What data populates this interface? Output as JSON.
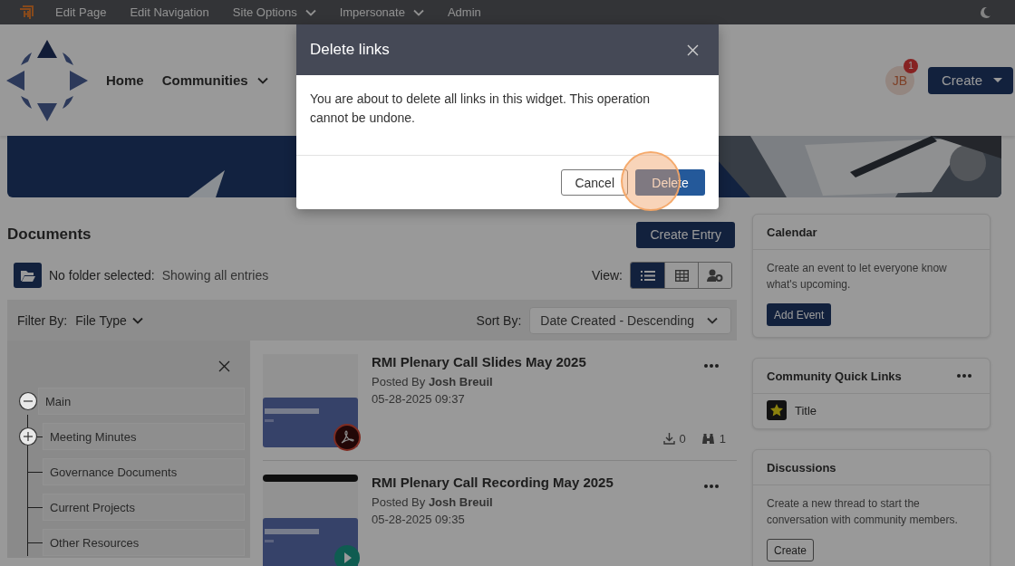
{
  "admin_bar": {
    "items": [
      {
        "label": "Edit Page",
        "dropdown": false
      },
      {
        "label": "Edit Navigation",
        "dropdown": false
      },
      {
        "label": "Site Options",
        "dropdown": true
      },
      {
        "label": "Impersonate",
        "dropdown": true
      },
      {
        "label": "Admin",
        "dropdown": false
      }
    ]
  },
  "header": {
    "nav": [
      {
        "label": "Home",
        "dropdown": false
      },
      {
        "label": "Communities",
        "dropdown": true
      }
    ],
    "avatar": {
      "initials": "JB",
      "badge": "1"
    },
    "create_button": "Create"
  },
  "documents": {
    "title": "Documents",
    "create_entry": "Create Entry",
    "folder_label": "No folder selected:",
    "folder_status": "Showing all entries",
    "view_label": "View:",
    "view_modes": [
      {
        "kind": "list",
        "selected": true
      },
      {
        "kind": "grid",
        "selected": false
      },
      {
        "kind": "settings",
        "selected": false
      }
    ],
    "filter_label": "Filter By:",
    "filter_value": "File Type",
    "sort_label": "Sort By:",
    "sort_value": "Date Created - Descending",
    "tree": [
      {
        "label": "Main",
        "expanded": true,
        "children": [
          {
            "label": "Meeting Minutes",
            "expanded": false
          },
          {
            "label": "Governance Documents"
          },
          {
            "label": "Current Projects"
          },
          {
            "label": "Other Resources"
          }
        ]
      }
    ],
    "entries": [
      {
        "title": "RMI Plenary Call Slides May 2025",
        "posted_by": "Posted By",
        "author": "Josh Breuil",
        "date": "05-28-2025 09:37",
        "kind": "pdf",
        "downloads": "0",
        "views": "1"
      },
      {
        "title": "RMI Plenary Call Recording May 2025",
        "posted_by": "Posted By",
        "author": "Josh Breuil",
        "date": "05-28-2025 09:35",
        "kind": "video"
      }
    ]
  },
  "sidebar": {
    "calendar": {
      "title": "Calendar",
      "text": "Create an event to let everyone know what's upcoming.",
      "button": "Add Event"
    },
    "quick_links": {
      "title": "Community Quick Links",
      "links": [
        {
          "label": "Title"
        }
      ]
    },
    "discussions": {
      "title": "Discussions",
      "text": "Create a new thread to start the conversation with community members.",
      "button": "Create"
    }
  },
  "dialog": {
    "title": "Delete links",
    "message": "You are about to delete all links in this widget. This operation cannot be undone.",
    "cancel": "Cancel",
    "confirm": {
      "label": "Delete",
      "highlighted": true
    }
  }
}
